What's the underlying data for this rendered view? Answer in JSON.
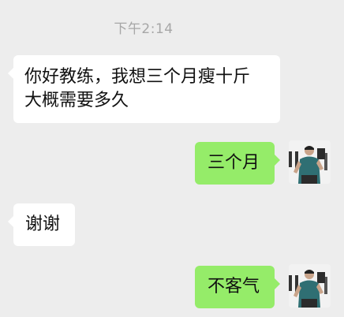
{
  "timestamp": "下午2:14",
  "messages": [
    {
      "side": "left",
      "text": "你好教练，我想三个月瘦十斤\n大概需要多久"
    },
    {
      "side": "right",
      "text": "三个月"
    },
    {
      "side": "left",
      "text": "谢谢"
    },
    {
      "side": "right",
      "text": "不客气"
    }
  ],
  "colors": {
    "background": "#ededed",
    "incoming_bubble": "#ffffff",
    "outgoing_bubble": "#95ec69",
    "timestamp_text": "#a7a7a7"
  },
  "icons": {
    "sender_avatar": "coach-avatar-photo"
  }
}
